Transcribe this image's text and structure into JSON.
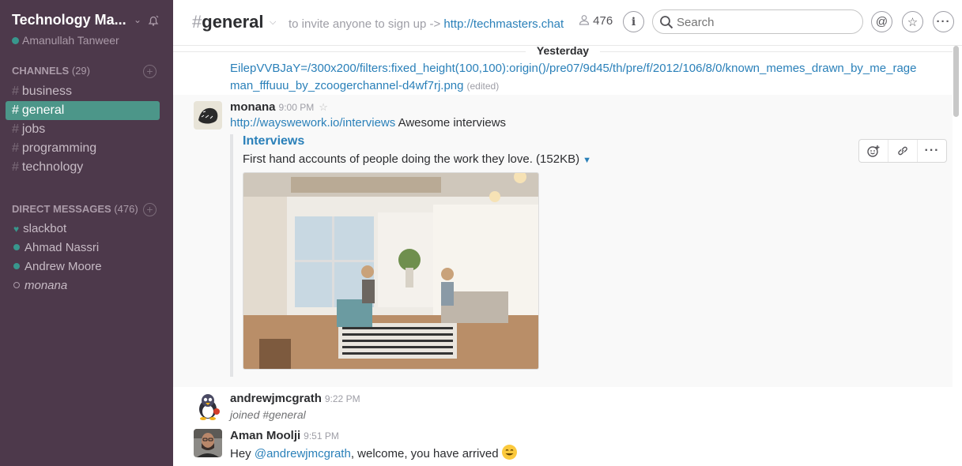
{
  "team": {
    "name": "Technology Ma...",
    "user": "Amanullah Tanweer"
  },
  "channels": {
    "header": "CHANNELS",
    "count": "(29)",
    "items": [
      {
        "label": "business",
        "active": false
      },
      {
        "label": "general",
        "active": true
      },
      {
        "label": "jobs",
        "active": false
      },
      {
        "label": "programming",
        "active": false
      },
      {
        "label": "technology",
        "active": false
      }
    ]
  },
  "direct_messages": {
    "header": "DIRECT MESSAGES",
    "count": "(476)",
    "items": [
      {
        "label": "slackbot",
        "status": "heart"
      },
      {
        "label": "Ahmad Nassri",
        "status": "online"
      },
      {
        "label": "Andrew Moore",
        "status": "online"
      },
      {
        "label": "monana",
        "status": "away"
      }
    ]
  },
  "header": {
    "channel": "general",
    "hash": "#",
    "topic_prefix": "to invite anyone to sign up ->",
    "topic_link": "http://techmasters.chat",
    "member_count": "476",
    "search_placeholder": "Search"
  },
  "day_divider": "Yesterday",
  "messages": {
    "continuation": {
      "line1": "EilepVVBJaY=/300x200/filters:fixed_height(100,100):origin()/pre07/9d45/th/pre/f/2012/106/8/0/known_memes_drawn_by_me_rage",
      "line2": "man_fffuuu_by_zcoogerchannel-d4wf7rj.png",
      "edited": "(edited)"
    },
    "monana": {
      "author": "monana",
      "time": "9:00 PM",
      "link": "http://wayswework.io/interviews",
      "text": "Awesome interviews",
      "attachment_title": "Interviews",
      "attachment_desc": "First hand accounts of people doing the work they love. (152KB)"
    },
    "andrew": {
      "author": "andrewjmcgrath",
      "time": "9:22 PM",
      "text": "joined #general"
    },
    "aman": {
      "author": "Aman Moolji",
      "time": "9:51 PM",
      "prefix": "Hey",
      "mention": "@andrewjmcgrath",
      "text": ", welcome, you have arrived"
    }
  },
  "colors": {
    "sidebar": "#4d394b",
    "active_channel": "#4c9689",
    "link": "#2a80b9",
    "presence": "#38978d"
  },
  "icons": [
    "bell-icon",
    "person-icon",
    "info-icon",
    "search-icon",
    "at-icon",
    "star-icon",
    "more-icon",
    "add-reaction-icon",
    "link-icon",
    "add-channel-icon"
  ]
}
